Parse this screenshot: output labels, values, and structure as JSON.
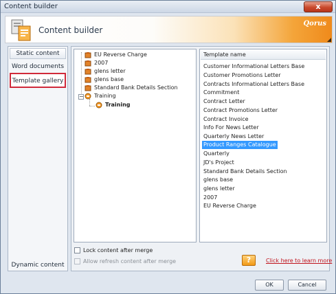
{
  "window": {
    "title": "Content builder",
    "close_label": "x"
  },
  "header": {
    "title": "Content builder",
    "brand": "Qorus"
  },
  "nav": {
    "static": "Static content",
    "word": "Word documents",
    "gallery": "Template gallery",
    "dynamic": "Dynamic content"
  },
  "tree": {
    "items": [
      "EU Reverse Charge",
      "2007",
      "glens letter",
      "glens base",
      "Standard Bank Details Section",
      "Training",
      "Training"
    ]
  },
  "list": {
    "header": "Template name",
    "items": [
      "Customer Informational Letters Base",
      "Customer Promotions Letter",
      "Contracts Informational Letters Base",
      "Commitment",
      "Contract Letter",
      "Contract Promotions Letter",
      "Contract Invoice",
      "Info For News Letter",
      "Quarterly News Letter",
      "Product Ranges Catalogue",
      "Quarterly",
      "JD's Project",
      "Standard Bank Details Section",
      "glens base",
      "glens letter",
      "2007",
      "EU Reverse Charge"
    ],
    "selected_index": 9
  },
  "options": {
    "lock": "Lock content after merge",
    "refresh": "Allow refresh content after merge"
  },
  "help": {
    "icon": "?",
    "link": "Click here to learn more"
  },
  "footer": {
    "ok": "OK",
    "cancel": "Cancel"
  }
}
